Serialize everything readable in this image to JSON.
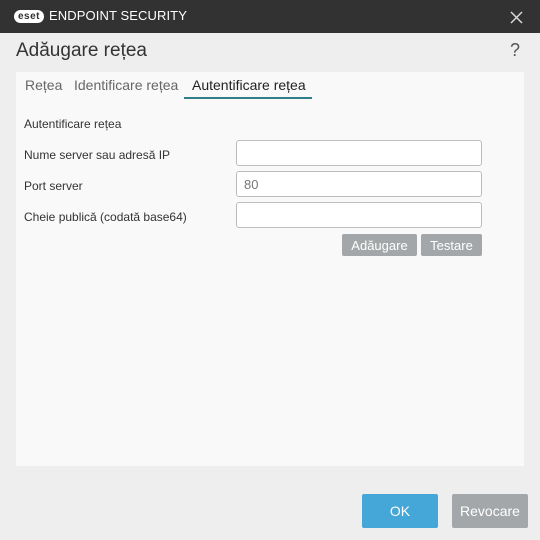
{
  "titlebar": {
    "logo_badge": "eset",
    "product_name": "ENDPOINT SECURITY",
    "close_icon": "close-icon"
  },
  "dialog": {
    "title": "Adăugare rețea",
    "help_label": "?"
  },
  "tabs": [
    {
      "label": "Rețea",
      "active": false
    },
    {
      "label": "Identificare rețea",
      "active": false
    },
    {
      "label": "Autentificare rețea",
      "active": true
    }
  ],
  "form": {
    "section_heading": "Autentificare rețea",
    "server_label": "Nume server sau adresă IP",
    "server_value": "",
    "port_label": "Port server",
    "port_value": "80",
    "key_label": "Cheie publică (codată base64)",
    "key_value": "",
    "add_button": "Adăugare",
    "test_button": "Testare"
  },
  "footer": {
    "ok_button": "OK",
    "cancel_button": "Revocare"
  },
  "colors": {
    "titlebar_bg": "#323232",
    "accent": "#2f7e8a",
    "ok_button": "#45a6d8",
    "secondary_button": "#a4a7a9"
  }
}
